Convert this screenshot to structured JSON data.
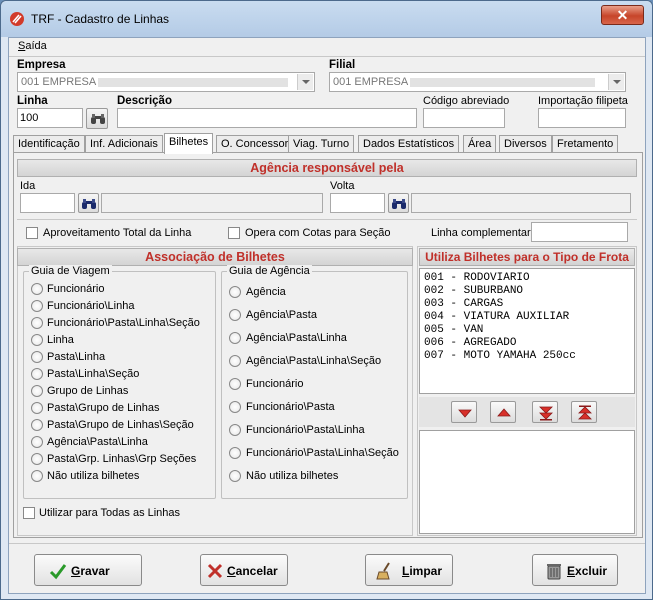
{
  "window": {
    "title": "TRF - Cadastro de Linhas",
    "close_glyph": "✕"
  },
  "menu": {
    "saida_first": "S",
    "saida_rest": "aída"
  },
  "empresa": {
    "label": "Empresa",
    "value": "001 EMPRESA"
  },
  "filial": {
    "label": "Filial",
    "value": "001 EMPRESA"
  },
  "linha": {
    "label": "Linha",
    "value": "100"
  },
  "descricao": {
    "label": "Descrição",
    "value": ""
  },
  "codigo_abreviado": {
    "label": "Código abreviado",
    "value": ""
  },
  "importacao_filipeta": {
    "label": "Importação filipeta",
    "value": ""
  },
  "tabs": [
    {
      "label": "Identificação"
    },
    {
      "label": "Inf. Adicionais"
    },
    {
      "label": "Bilhetes"
    },
    {
      "label": "O. Concessor"
    },
    {
      "label": "Viag. Turno"
    },
    {
      "label": "Dados Estatísticos"
    },
    {
      "label": "Área"
    },
    {
      "label": "Diversos"
    },
    {
      "label": "Fretamento"
    }
  ],
  "agencia": {
    "header": "Agência responsável pela",
    "ida_label": "Ida",
    "volta_label": "Volta"
  },
  "options": {
    "aproveitamento": "Aproveitamento Total da Linha",
    "opera_cotas": "Opera com Cotas para Seção",
    "linha_complementar": "Linha complementar"
  },
  "associacao": {
    "header": "Associação de Bilhetes",
    "guia_viagem": {
      "title": "Guia de Viagem",
      "items": [
        "Funcionário",
        "Funcionário\\Linha",
        "Funcionário\\Pasta\\Linha\\Seção",
        "Linha",
        "Pasta\\Linha",
        "Pasta\\Linha\\Seção",
        "Grupo de Linhas",
        "Pasta\\Grupo de Linhas",
        "Pasta\\Grupo de Linhas\\Seção",
        "Agência\\Pasta\\Linha",
        "Pasta\\Grp. Linhas\\Grp Seções",
        "Não utiliza bilhetes"
      ]
    },
    "guia_agencia": {
      "title": "Guia de Agência",
      "items": [
        "Agência",
        "Agência\\Pasta",
        "Agência\\Pasta\\Linha",
        "Agência\\Pasta\\Linha\\Seção",
        "Funcionário",
        "Funcionário\\Pasta",
        "Funcionário\\Pasta\\Linha",
        "Funcionário\\Pasta\\Linha\\Seção",
        "Não utiliza bilhetes"
      ]
    },
    "utilizar_todas": "Utilizar para Todas as Linhas"
  },
  "frota": {
    "header": "Utiliza Bilhetes para o Tipo de Frota",
    "items": [
      "001 - RODOVIARIO",
      "002 - SUBURBANO",
      "003 - CARGAS",
      "004 - VIATURA AUXILIAR",
      "005 - VAN",
      "006 - AGREGADO",
      "007 - MOTO YAMAHA 250cc"
    ]
  },
  "buttons": {
    "gravar_first": "G",
    "gravar_rest": "ravar",
    "cancelar_first": "C",
    "cancelar_rest": "ancelar",
    "limpar_first": "L",
    "limpar_rest": "impar",
    "excluir_first": "E",
    "excluir_rest": "xcluir"
  },
  "colors": {
    "accent_red": "#c0302a",
    "frame_blue": "#6a8fb8"
  }
}
